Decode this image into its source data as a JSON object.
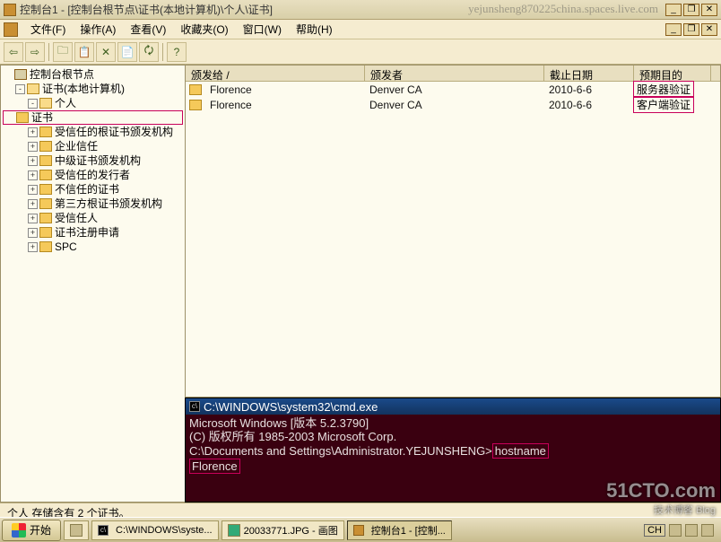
{
  "titlebar": {
    "text": "控制台1 - [控制台根节点\\证书(本地计算机)\\个人\\证书]"
  },
  "watermark_url": "yejunsheng870225china.spaces.live.com",
  "menu": {
    "file": "文件(F)",
    "action": "操作(A)",
    "view": "查看(V)",
    "fav": "收藏夹(O)",
    "window": "窗口(W)",
    "help": "帮助(H)"
  },
  "toolbar_icons": [
    "back-icon",
    "forward-icon",
    "up-icon",
    "props-icon",
    "delete-icon",
    "refresh-icon",
    "export-icon",
    "help-icon"
  ],
  "tree": {
    "root": "控制台根节点",
    "cert_root": "证书(本地计算机)",
    "personal": "个人",
    "selected": "证书",
    "trusted_root": "受信任的根证书颁发机构",
    "enterprise": "企业信任",
    "intermediate": "中级证书颁发机构",
    "trusted_pub": "受信任的发行者",
    "untrusted": "不信任的证书",
    "third_party": "第三方根证书颁发机构",
    "trusted_people": "受信任人",
    "enroll_req": "证书注册申请",
    "spc": "SPC"
  },
  "list": {
    "cols": {
      "c1": "颁发给  /",
      "c2": "颁发者",
      "c3": "截止日期",
      "c4": "预期目的"
    },
    "rows": [
      {
        "to": "Florence",
        "by": "Denver CA",
        "exp": "2010-6-6",
        "purpose": "服务器验证"
      },
      {
        "to": "Florence",
        "by": "Denver CA",
        "exp": "2010-6-6",
        "purpose": "客户端验证"
      }
    ]
  },
  "console": {
    "title": "C:\\WINDOWS\\system32\\cmd.exe",
    "line1": "Microsoft Windows [版本 5.2.3790]",
    "line2": "(C) 版权所有 1985-2003 Microsoft Corp.",
    "blank": "",
    "prompt": "C:\\Documents and Settings\\Administrator.YEJUNSHENG>",
    "cmd": "hostname",
    "out": "Florence"
  },
  "status": "个人 存储含有 2 个证书。",
  "taskbar": {
    "start": "开始",
    "t1": "C:\\WINDOWS\\syste...",
    "t2": "20033771.JPG - 画图",
    "t3": "控制台1 - [控制...",
    "lang": "CH"
  },
  "brand": {
    "main": "51CTO.com",
    "sub": "技术博客  Blog"
  }
}
